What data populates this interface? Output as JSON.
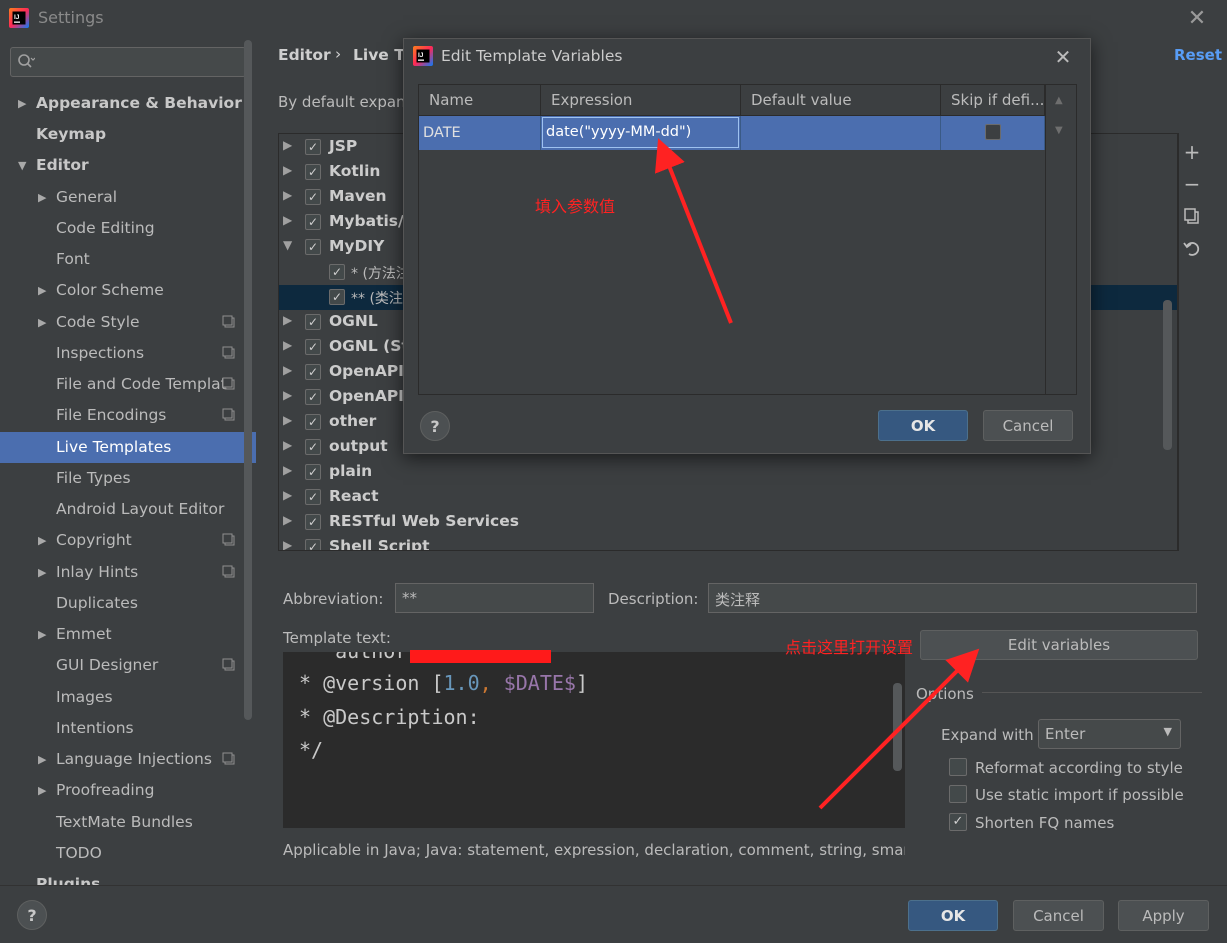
{
  "window": {
    "title": "Settings"
  },
  "search": {
    "placeholder": ""
  },
  "sidebar": {
    "items": [
      {
        "label": "Appearance & Behavior"
      },
      {
        "label": "Keymap"
      },
      {
        "label": "Editor"
      },
      {
        "label": "General"
      },
      {
        "label": "Code Editing"
      },
      {
        "label": "Font"
      },
      {
        "label": "Color Scheme"
      },
      {
        "label": "Code Style"
      },
      {
        "label": "Inspections"
      },
      {
        "label": "File and Code Templat"
      },
      {
        "label": "File Encodings"
      },
      {
        "label": "Live Templates"
      },
      {
        "label": "File Types"
      },
      {
        "label": "Android Layout Editor"
      },
      {
        "label": "Copyright"
      },
      {
        "label": "Inlay Hints"
      },
      {
        "label": "Duplicates"
      },
      {
        "label": "Emmet"
      },
      {
        "label": "GUI Designer"
      },
      {
        "label": "Images"
      },
      {
        "label": "Intentions"
      },
      {
        "label": "Language Injections"
      },
      {
        "label": "Proofreading"
      },
      {
        "label": "TextMate Bundles"
      },
      {
        "label": "TODO"
      },
      {
        "label": "Plugins"
      }
    ]
  },
  "header": {
    "breadcrumb_editor": "Editor",
    "breadcrumb_sep": "›",
    "breadcrumb_live": "Live Te",
    "reset": "Reset",
    "intro": "By default expand"
  },
  "tree": {
    "items": [
      {
        "label": "JSP"
      },
      {
        "label": "Kotlin"
      },
      {
        "label": "Maven"
      },
      {
        "label": "Mybatis/S"
      },
      {
        "label": "MyDIY"
      },
      {
        "label": "* (方法注"
      },
      {
        "label": "** (类注"
      },
      {
        "label": "OGNL"
      },
      {
        "label": "OGNL (Str"
      },
      {
        "label": "OpenAPI S"
      },
      {
        "label": "OpenAPI S"
      },
      {
        "label": "other"
      },
      {
        "label": "output"
      },
      {
        "label": "plain"
      },
      {
        "label": "React"
      },
      {
        "label": "RESTful Web Services"
      },
      {
        "label": "Shell Script"
      }
    ]
  },
  "form": {
    "abbreviation_label": "Abbreviation:",
    "abbreviation_value": "**",
    "description_label": "Description:",
    "description_value": "类注释",
    "template_text_label": "Template text:",
    "code_lines": [
      "  *author:",
      "* @version [1.0, $DATE$]",
      "* @Description:",
      "*/"
    ],
    "edit_variables": "Edit variables",
    "applicable": "Applicable in Java; Java: statement, expression, declaration, comment, string, smart ty"
  },
  "options": {
    "title": "Options",
    "expand_with_label": "Expand with",
    "expand_with_value": "Enter",
    "reformat": "Reformat according to style",
    "static_import": "Use static import if possible",
    "shorten": "Shorten FQ names"
  },
  "footer": {
    "help": "?",
    "ok": "OK",
    "cancel": "Cancel",
    "apply": "Apply"
  },
  "dialog": {
    "title": "Edit Template Variables",
    "columns": [
      "Name",
      "Expression",
      "Default value",
      "Skip if defi..."
    ],
    "row": {
      "name": "DATE",
      "expression": "date(\"yyyy-MM-dd\")",
      "default": ""
    },
    "help": "?",
    "ok": "OK",
    "cancel": "Cancel"
  },
  "annotations": {
    "fill_value": "填入参数值",
    "click_here": "点击这里打开设置"
  },
  "colors": {
    "selection": "#4b6eaf",
    "accent_link": "#589df6",
    "annotation": "#ff2222",
    "primary_button": "#365880"
  }
}
